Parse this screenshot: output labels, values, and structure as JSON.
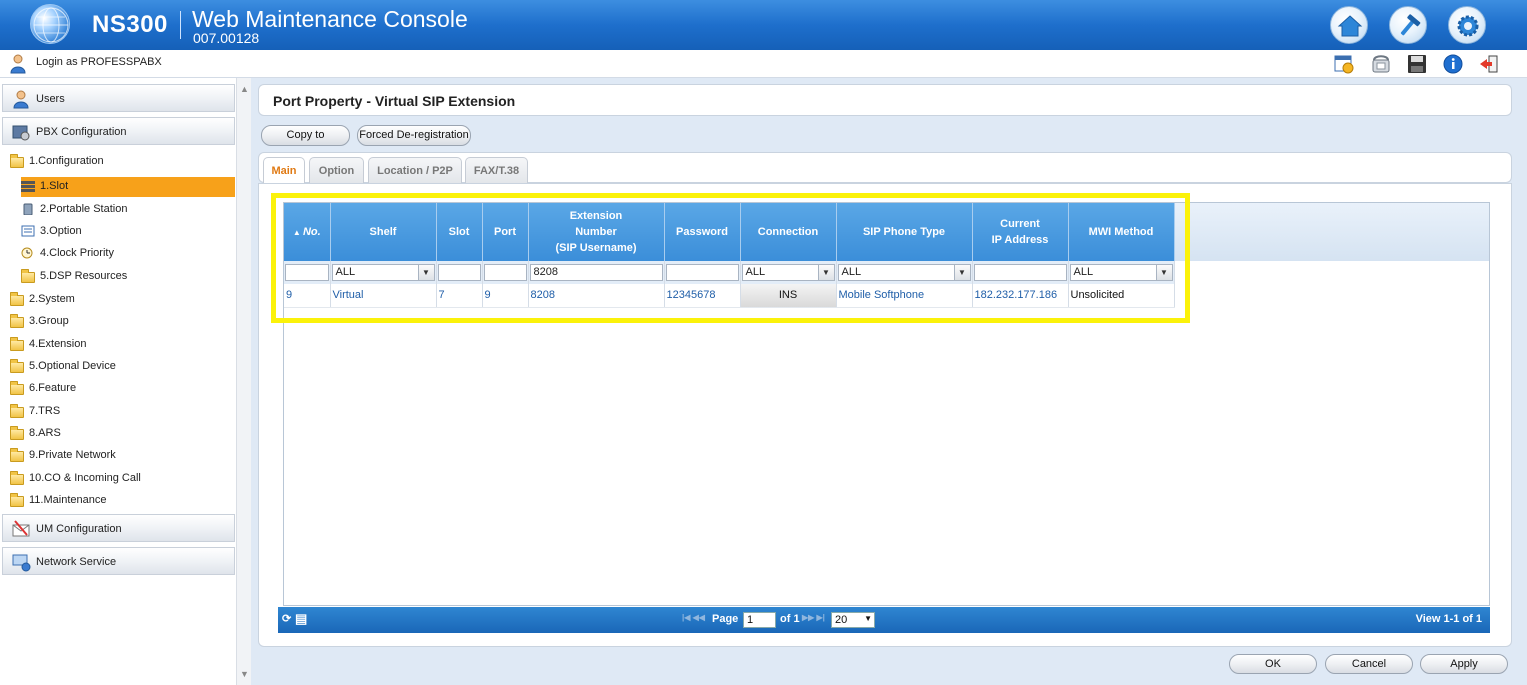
{
  "header": {
    "model": "NS300",
    "app_title": "Web Maintenance Console",
    "version": "007.00128",
    "icons": [
      "home-icon",
      "tools-icon",
      "settings-icon"
    ]
  },
  "loginbar": {
    "login_text": "Login as PROFESSPABX",
    "tools": [
      "calendar-icon",
      "phone-icon",
      "save-icon",
      "info-icon",
      "logout-icon"
    ]
  },
  "sidebar": {
    "users": "Users",
    "pbx_configuration": "PBX Configuration",
    "tree": [
      {
        "label": "1.Configuration",
        "level": 0,
        "open": true
      },
      {
        "label": "1.Slot",
        "level": 1,
        "selected": true
      },
      {
        "label": "2.Portable Station",
        "level": 1
      },
      {
        "label": "3.Option",
        "level": 1
      },
      {
        "label": "4.Clock Priority",
        "level": 1
      },
      {
        "label": "5.DSP Resources",
        "level": 1
      },
      {
        "label": "2.System",
        "level": 0
      },
      {
        "label": "3.Group",
        "level": 0
      },
      {
        "label": "4.Extension",
        "level": 0
      },
      {
        "label": "5.Optional Device",
        "level": 0
      },
      {
        "label": "6.Feature",
        "level": 0
      },
      {
        "label": "7.TRS",
        "level": 0
      },
      {
        "label": "8.ARS",
        "level": 0
      },
      {
        "label": "9.Private Network",
        "level": 0
      },
      {
        "label": "10.CO & Incoming Call",
        "level": 0
      },
      {
        "label": "11.Maintenance",
        "level": 0
      }
    ],
    "um_configuration": "UM Configuration",
    "network_service": "Network Service"
  },
  "page": {
    "title": "Port Property - Virtual SIP Extension",
    "copy_to": "Copy to",
    "forced_dereg": "Forced De-registration",
    "tabs": [
      "Main",
      "Option",
      "Location / P2P",
      "FAX/T.38"
    ]
  },
  "grid": {
    "columns": [
      "No.",
      "Shelf",
      "Slot",
      "Port",
      "Extension Number (SIP Username)",
      "Password",
      "Connection",
      "SIP Phone Type",
      "Current IP Address",
      "MWI Method"
    ],
    "col_no": "No.",
    "col_shelf": "Shelf",
    "col_slot": "Slot",
    "col_port": "Port",
    "col_ext_1": "Extension",
    "col_ext_2": "Number",
    "col_ext_3": "(SIP Username)",
    "col_password": "Password",
    "col_connection": "Connection",
    "col_sip_type": "SIP Phone Type",
    "col_ip_1": "Current",
    "col_ip_2": "IP Address",
    "col_mwi": "MWI Method",
    "filters": {
      "shelf": "ALL",
      "ext": "8208",
      "connection": "ALL",
      "sip_type": "ALL",
      "mwi": "ALL"
    },
    "row": {
      "no": "9",
      "shelf": "Virtual",
      "slot": "7",
      "port": "9",
      "ext": "8208",
      "password": "12345678",
      "connection": "INS",
      "sip_type": "Mobile Softphone",
      "ip": "182.232.177.186",
      "mwi": "Unsolicited"
    }
  },
  "pager": {
    "page_label": "Page",
    "page_value": "1",
    "of_label": "of 1",
    "per_page": "20",
    "view_text": "View 1-1 of 1"
  },
  "footer": {
    "ok": "OK",
    "cancel": "Cancel",
    "apply": "Apply"
  },
  "colors": {
    "header_blue": "#1e6fcc",
    "selected_orange": "#f7a11a",
    "grid_header": "#3b8ed9",
    "highlight_yellow": "#fbf20a"
  }
}
